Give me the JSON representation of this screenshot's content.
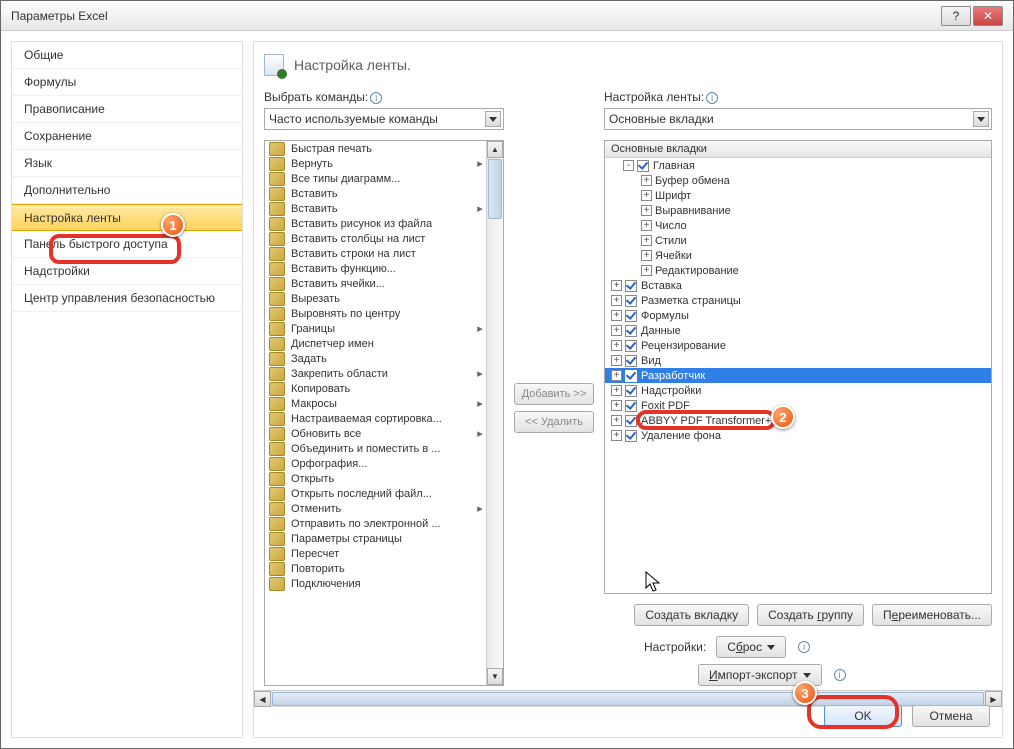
{
  "window": {
    "title": "Параметры Excel"
  },
  "nav": [
    "Общие",
    "Формулы",
    "Правописание",
    "Сохранение",
    "Язык",
    "Дополнительно",
    "Настройка ленты",
    "Панель быстрого доступа",
    "Надстройки",
    "Центр управления безопасностью"
  ],
  "nav_selected": 6,
  "header": "Настройка ленты.",
  "left": {
    "label": "Выбрать команды:",
    "dropdown": "Часто используемые команды",
    "commands": [
      {
        "t": "Быстрая печать"
      },
      {
        "t": "Вернуть",
        "f": 1
      },
      {
        "t": "Все типы диаграмм..."
      },
      {
        "t": "Вставить"
      },
      {
        "t": "Вставить",
        "f": 1
      },
      {
        "t": "Вставить рисунок из файла"
      },
      {
        "t": "Вставить столбцы на лист"
      },
      {
        "t": "Вставить строки на лист"
      },
      {
        "t": "Вставить функцию..."
      },
      {
        "t": "Вставить ячейки..."
      },
      {
        "t": "Вырезать"
      },
      {
        "t": "Выровнять по центру"
      },
      {
        "t": "Границы",
        "f": 1
      },
      {
        "t": "Диспетчер имен"
      },
      {
        "t": "Задать"
      },
      {
        "t": "Закрепить области",
        "f": 1
      },
      {
        "t": "Копировать"
      },
      {
        "t": "Макросы",
        "f": 1
      },
      {
        "t": "Настраиваемая сортировка..."
      },
      {
        "t": "Обновить все",
        "f": 1
      },
      {
        "t": "Объединить и поместить в ..."
      },
      {
        "t": "Орфография..."
      },
      {
        "t": "Открыть"
      },
      {
        "t": "Открыть последний файл..."
      },
      {
        "t": "Отменить",
        "f": 1
      },
      {
        "t": "Отправить по электронной ..."
      },
      {
        "t": "Параметры страницы"
      },
      {
        "t": "Пересчет"
      },
      {
        "t": "Повторить"
      },
      {
        "t": "Подключения"
      }
    ]
  },
  "mid": {
    "add": "Добавить >>",
    "remove": "<< Удалить"
  },
  "right": {
    "label": "Настройка ленты:",
    "dropdown": "Основные вкладки",
    "treehdr": "Основные вкладки",
    "tree": [
      {
        "ind": 18,
        "tog": "-",
        "cb": 1,
        "t": "Главная"
      },
      {
        "ind": 36,
        "tog": "+",
        "t": "Буфер обмена"
      },
      {
        "ind": 36,
        "tog": "+",
        "t": "Шрифт"
      },
      {
        "ind": 36,
        "tog": "+",
        "t": "Выравнивание"
      },
      {
        "ind": 36,
        "tog": "+",
        "t": "Число"
      },
      {
        "ind": 36,
        "tog": "+",
        "t": "Стили"
      },
      {
        "ind": 36,
        "tog": "+",
        "t": "Ячейки"
      },
      {
        "ind": 36,
        "tog": "+",
        "t": "Редактирование"
      },
      {
        "ind": 6,
        "tog": "+",
        "cb": 1,
        "t": "Вставка"
      },
      {
        "ind": 6,
        "tog": "+",
        "cb": 1,
        "t": "Разметка страницы"
      },
      {
        "ind": 6,
        "tog": "+",
        "cb": 1,
        "t": "Формулы"
      },
      {
        "ind": 6,
        "tog": "+",
        "cb": 1,
        "t": "Данные"
      },
      {
        "ind": 6,
        "tog": "+",
        "cb": 1,
        "t": "Рецензирование"
      },
      {
        "ind": 6,
        "tog": "+",
        "cb": 1,
        "t": "Вид"
      },
      {
        "ind": 6,
        "tog": "+",
        "cb": 1,
        "t": "Разработчик",
        "sel": 1
      },
      {
        "ind": 6,
        "tog": "+",
        "cb": 1,
        "t": "Надстройки"
      },
      {
        "ind": 6,
        "tog": "+",
        "cb": 1,
        "t": "Foxit PDF"
      },
      {
        "ind": 6,
        "tog": "+",
        "cb": 1,
        "t": "ABBYY PDF Transformer+"
      },
      {
        "ind": 6,
        "tog": "+",
        "cb": 1,
        "t": "Удаление фона"
      }
    ],
    "btns": {
      "newtab_pre": "Создать вкла",
      "newtab_u": "д",
      "newtab_suf": "ку",
      "newgrp_pre": "Создать ",
      "newgrp_u": "г",
      "newgrp_suf": "руппу",
      "rename_pre": "П",
      "rename_u": "е",
      "rename_suf": "реименовать..."
    },
    "settings_label": "Настройки:",
    "reset_pre": "С",
    "reset_u": "б",
    "reset_suf": "рос",
    "impexp_pre": "",
    "impexp_u": "И",
    "impexp_suf": "мпорт-экспорт"
  },
  "footer": {
    "ok": "OK",
    "cancel": "Отмена"
  },
  "badges": {
    "b1": "1",
    "b2": "2",
    "b3": "3"
  }
}
